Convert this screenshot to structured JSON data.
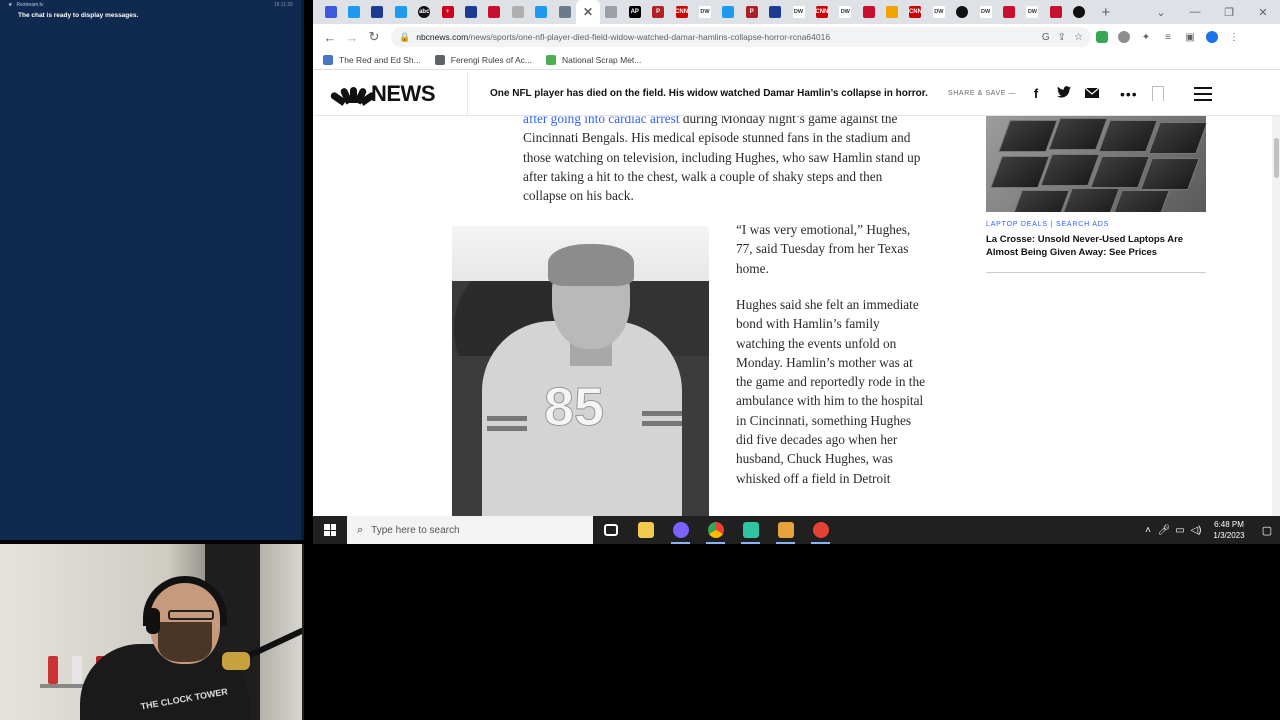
{
  "chat": {
    "channel": "Restream.tv",
    "time": "18:11:35",
    "message": "The chat is ready to display messages."
  },
  "webcam": {
    "shirt_text": "THE CLOCK TOWER"
  },
  "browser": {
    "tabs": [
      {
        "icon": "nbc-news-favicon-icon",
        "color": "#3b5bdb",
        "label": ""
      },
      {
        "icon": "twitter-favicon-icon",
        "color": "#1d9bf0",
        "label": ""
      },
      {
        "icon": "yahoo-sports-favicon-icon",
        "color": "#1f3a93",
        "label": ""
      },
      {
        "icon": "twitter-favicon-icon",
        "color": "#1d9bf0",
        "label": ""
      },
      {
        "icon": "abc-news-favicon-icon",
        "color": "#111111",
        "label": "abc"
      },
      {
        "icon": "cross-favicon-icon",
        "color": "#d0021b",
        "label": "+"
      },
      {
        "icon": "yahoo-sports-favicon-icon",
        "color": "#1f3a93",
        "label": ""
      },
      {
        "icon": "red-news-favicon-icon",
        "color": "#c8102e",
        "label": ""
      },
      {
        "icon": "news-favicon-icon",
        "color": "#b0b0b0",
        "label": ""
      },
      {
        "icon": "twitter-favicon-icon",
        "color": "#1d9bf0",
        "label": ""
      },
      {
        "icon": "site-favicon-icon",
        "color": "#6b7b8c",
        "label": ""
      },
      {
        "icon": "close-tab-icon",
        "color": "#ffffff",
        "label": "✕"
      },
      {
        "icon": "news-favicon-icon",
        "color": "#9aa0a6",
        "label": ""
      },
      {
        "icon": "ap-favicon-icon",
        "color": "#000000",
        "label": "AP"
      },
      {
        "icon": "politico-favicon-icon",
        "color": "#b01f24",
        "label": "P"
      },
      {
        "icon": "cnn-favicon-icon",
        "color": "#cc0000",
        "label": "CNN"
      },
      {
        "icon": "dw-favicon-icon",
        "color": "#ffffff",
        "label": "DW"
      },
      {
        "icon": "twitter-favicon-icon",
        "color": "#1d9bf0",
        "label": ""
      },
      {
        "icon": "politico-favicon-icon",
        "color": "#b01f24",
        "label": "P"
      },
      {
        "icon": "yahoo-sports-favicon-icon",
        "color": "#1f3a93",
        "label": ""
      },
      {
        "icon": "dw-favicon-icon",
        "color": "#ffffff",
        "label": "DW"
      },
      {
        "icon": "cnn-favicon-icon",
        "color": "#cc0000",
        "label": "CNN"
      },
      {
        "icon": "dw-favicon-icon",
        "color": "#ffffff",
        "label": "DW"
      },
      {
        "icon": "red-news-favicon-icon",
        "color": "#c8102e",
        "label": ""
      },
      {
        "icon": "site-favicon-icon",
        "color": "#f0a500",
        "label": ""
      },
      {
        "icon": "cnn-favicon-icon",
        "color": "#cc0000",
        "label": "CNN"
      },
      {
        "icon": "dw-favicon-icon",
        "color": "#ffffff",
        "label": "DW"
      },
      {
        "icon": "globe-favicon-icon",
        "color": "#111111",
        "label": ""
      },
      {
        "icon": "dw-favicon-icon",
        "color": "#ffffff",
        "label": "DW"
      },
      {
        "icon": "red-news-favicon-icon",
        "color": "#c8102e",
        "label": ""
      },
      {
        "icon": "dw-favicon-icon",
        "color": "#ffffff",
        "label": "DW"
      },
      {
        "icon": "red-news-favicon-icon",
        "color": "#c8102e",
        "label": ""
      },
      {
        "icon": "site-favicon-icon",
        "color": "#111111",
        "label": ""
      }
    ],
    "new_tab": "+",
    "window_controls": {
      "chevron": "⌄",
      "minimize": "—",
      "maximize": "❐",
      "close": "✕"
    },
    "url_domain": "nbcnews.com",
    "url_path": "/news/sports/one-nfl-player-died-field-widow-watched-damar-hamlins-collapse-horror-rcna64016",
    "bookmarks": [
      {
        "label": "The Red and Ed Sh...",
        "color": "#4a76c8"
      },
      {
        "label": "Ferengi Rules of Ac...",
        "color": "#5f6368"
      },
      {
        "label": "National Scrap Met...",
        "color": "#4caf50"
      }
    ]
  },
  "nbc": {
    "logo_text": "NEWS",
    "headline": "One NFL player has died on the field. His widow watched Damar Hamlin’s collapse in horror.",
    "share_label": "SHARE & SAVE —",
    "facebook": "f",
    "more": "•••"
  },
  "article": {
    "para1_link": "after going into cardiac arrest",
    "para1_rest": " during Monday night’s game against the Cincinnati Bengals. His medical episode stunned fans in the stadium and those watching on television, including Hughes, who saw Hamlin stand up after taking a hit to the chest, walk a couple of shaky steps and then collapse on his back.",
    "photo_number": "85",
    "quote": "“I was very emotional,” Hughes, 77, said Tuesday from her Texas home.",
    "para3": "Hughes said she felt an immediate bond with Hamlin’s family watching the events unfold on Monday. Hamlin’s mother was at the game and reportedly rode in the ambulance with him to the hospital in Cincinnati, something Hughes did five decades ago when her husband, Chuck Hughes, was whisked off a field in Detroit"
  },
  "ad": {
    "tag": "LAPTOP DEALS | SEARCH ADS",
    "title": "La Crosse: Unsold Never-Used Laptops Are Almost Being Given Away: See Prices"
  },
  "taskbar": {
    "search_placeholder": "Type here to search",
    "apps": [
      {
        "icon": "task-view-icon",
        "color": "#ffffff",
        "running": false
      },
      {
        "icon": "file-explorer-icon",
        "color": "#f2c94c",
        "running": false
      },
      {
        "icon": "discord-icon",
        "color": "#7b61ff",
        "running": true
      },
      {
        "icon": "chrome-icon",
        "color": "#34a853",
        "running": true
      },
      {
        "icon": "streamlabs-icon",
        "color": "#31c3a2",
        "running": true
      },
      {
        "icon": "media-player-icon",
        "color": "#e8a33d",
        "running": true
      },
      {
        "icon": "restream-icon",
        "color": "#e34234",
        "running": true
      }
    ],
    "time": "6:48 PM",
    "date": "1/3/2023"
  }
}
